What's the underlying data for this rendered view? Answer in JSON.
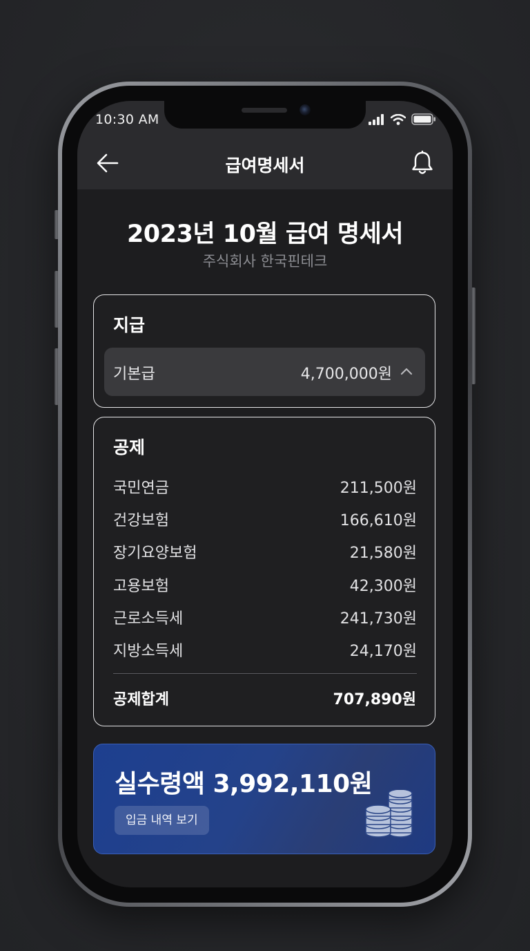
{
  "status_bar": {
    "time": "10:30 AM",
    "icons": [
      "signal-icon",
      "wifi-icon",
      "battery-icon"
    ]
  },
  "header": {
    "title": "급여명세서",
    "back_icon": "arrow-left-icon",
    "notification_icon": "bell-icon"
  },
  "document": {
    "title": "2023년 10월 급여 명세서",
    "company": "주식회사 한국핀테크"
  },
  "payment": {
    "section_title": "지급",
    "items": [
      {
        "label": "기본급",
        "amount": "4,700,000원",
        "icon": "chevron-up-icon"
      }
    ]
  },
  "deductions": {
    "section_title": "공제",
    "items": [
      {
        "label": "국민연금",
        "amount": "211,500원"
      },
      {
        "label": "건강보험",
        "amount": "166,610원"
      },
      {
        "label": "장기요양보험",
        "amount": "21,580원"
      },
      {
        "label": "고용보험",
        "amount": "42,300원"
      },
      {
        "label": "근로소득세",
        "amount": "241,730원"
      },
      {
        "label": "지방소득세",
        "amount": "24,170원"
      }
    ],
    "total_label": "공제합계",
    "total_amount": "707,890원"
  },
  "net_pay": {
    "title": "실수령액 3,992,110원",
    "button_label": "입금 내역 보기",
    "icon": "coins-icon"
  },
  "colors": {
    "background": "#1d1d1f",
    "header": "#2b2b2e",
    "card_border": "#e6e6e8",
    "net_card": "#24428a"
  }
}
